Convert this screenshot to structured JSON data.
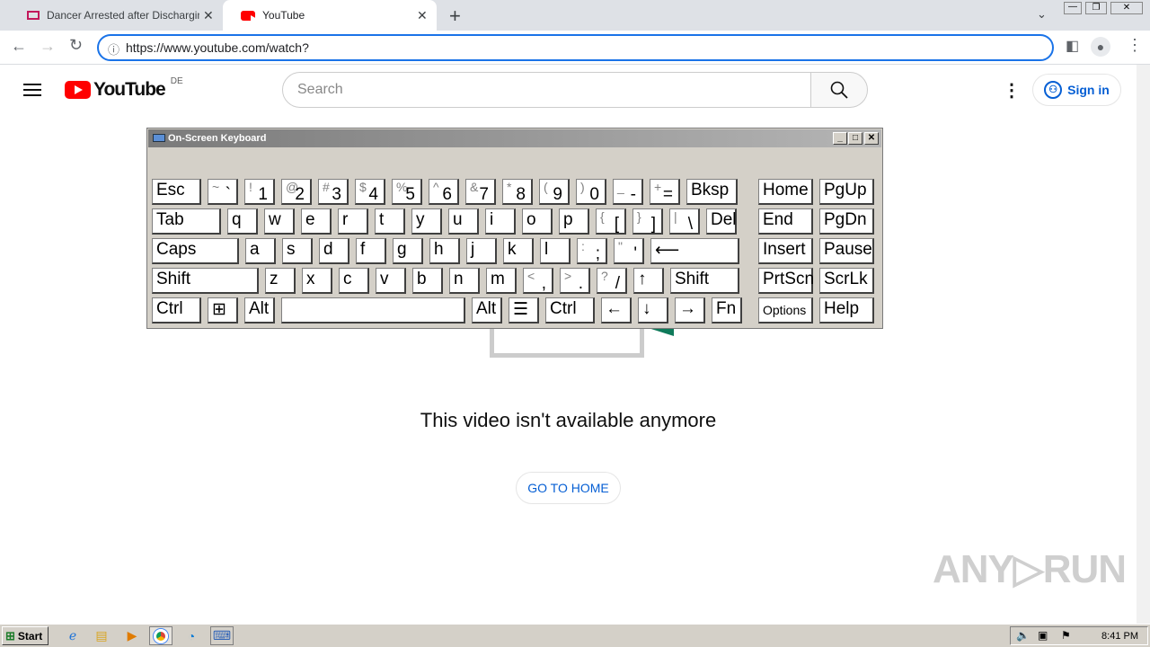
{
  "browser": {
    "tabs": [
      {
        "title": "Dancer Arrested after Discharging G",
        "active": false
      },
      {
        "title": "YouTube",
        "active": true
      }
    ],
    "new_tab": "+",
    "url": "https://www.youtube.com/watch?"
  },
  "youtube": {
    "logo_text": "YouTube",
    "region": "DE",
    "search_placeholder": "Search",
    "sign_in": "Sign in",
    "message": "This video isn't available anymore",
    "go_home": "GO TO HOME"
  },
  "osk": {
    "title": "On-Screen Keyboard",
    "rows": [
      [
        [
          "Esc",
          ""
        ],
        [
          "`",
          "~"
        ],
        [
          "1",
          "!"
        ],
        [
          "2",
          "@"
        ],
        [
          "3",
          "#"
        ],
        [
          "4",
          "$"
        ],
        [
          "5",
          "%"
        ],
        [
          "6",
          "^"
        ],
        [
          "7",
          "&"
        ],
        [
          "8",
          "*"
        ],
        [
          "9",
          "("
        ],
        [
          "0",
          ")"
        ],
        [
          "-",
          "_"
        ],
        [
          "=",
          "+"
        ],
        [
          "Bksp",
          ""
        ],
        [
          "Home",
          ""
        ],
        [
          "PgUp",
          ""
        ]
      ],
      [
        [
          "Tab",
          ""
        ],
        [
          "q",
          ""
        ],
        [
          "w",
          ""
        ],
        [
          "e",
          ""
        ],
        [
          "r",
          ""
        ],
        [
          "t",
          ""
        ],
        [
          "y",
          ""
        ],
        [
          "u",
          ""
        ],
        [
          "i",
          ""
        ],
        [
          "o",
          ""
        ],
        [
          "p",
          ""
        ],
        [
          "[",
          "{"
        ],
        [
          "]",
          "}"
        ],
        [
          "\\",
          "|"
        ],
        [
          "Del",
          ""
        ],
        [
          "End",
          ""
        ],
        [
          "PgDn",
          ""
        ]
      ],
      [
        [
          "Caps",
          ""
        ],
        [
          "a",
          ""
        ],
        [
          "s",
          ""
        ],
        [
          "d",
          ""
        ],
        [
          "f",
          ""
        ],
        [
          "g",
          ""
        ],
        [
          "h",
          ""
        ],
        [
          "j",
          ""
        ],
        [
          "k",
          ""
        ],
        [
          "l",
          ""
        ],
        [
          ";",
          ":"
        ],
        [
          "'",
          "\""
        ],
        [
          "⟵",
          ""
        ],
        [
          "Insert",
          ""
        ],
        [
          "Pause",
          ""
        ]
      ],
      [
        [
          "Shift",
          ""
        ],
        [
          "z",
          ""
        ],
        [
          "x",
          ""
        ],
        [
          "c",
          ""
        ],
        [
          "v",
          ""
        ],
        [
          "b",
          ""
        ],
        [
          "n",
          ""
        ],
        [
          "m",
          ""
        ],
        [
          ",",
          "<"
        ],
        [
          ".",
          ">"
        ],
        [
          "/",
          "?"
        ],
        [
          "↑",
          ""
        ],
        [
          "Shift",
          ""
        ],
        [
          "PrtScn",
          ""
        ],
        [
          "ScrLk",
          ""
        ]
      ],
      [
        [
          "Ctrl",
          ""
        ],
        [
          "⊞",
          ""
        ],
        [
          "Alt",
          ""
        ],
        [
          "",
          ""
        ],
        [
          "Alt",
          ""
        ],
        [
          "☰",
          ""
        ],
        [
          "Ctrl",
          ""
        ],
        [
          "←",
          ""
        ],
        [
          "↓",
          ""
        ],
        [
          "→",
          ""
        ],
        [
          "Fn",
          ""
        ],
        [
          "Options",
          ""
        ],
        [
          "Help",
          ""
        ]
      ]
    ]
  },
  "taskbar": {
    "start": "Start",
    "time": "8:41 PM"
  },
  "watermark": "ANY▷RUN"
}
